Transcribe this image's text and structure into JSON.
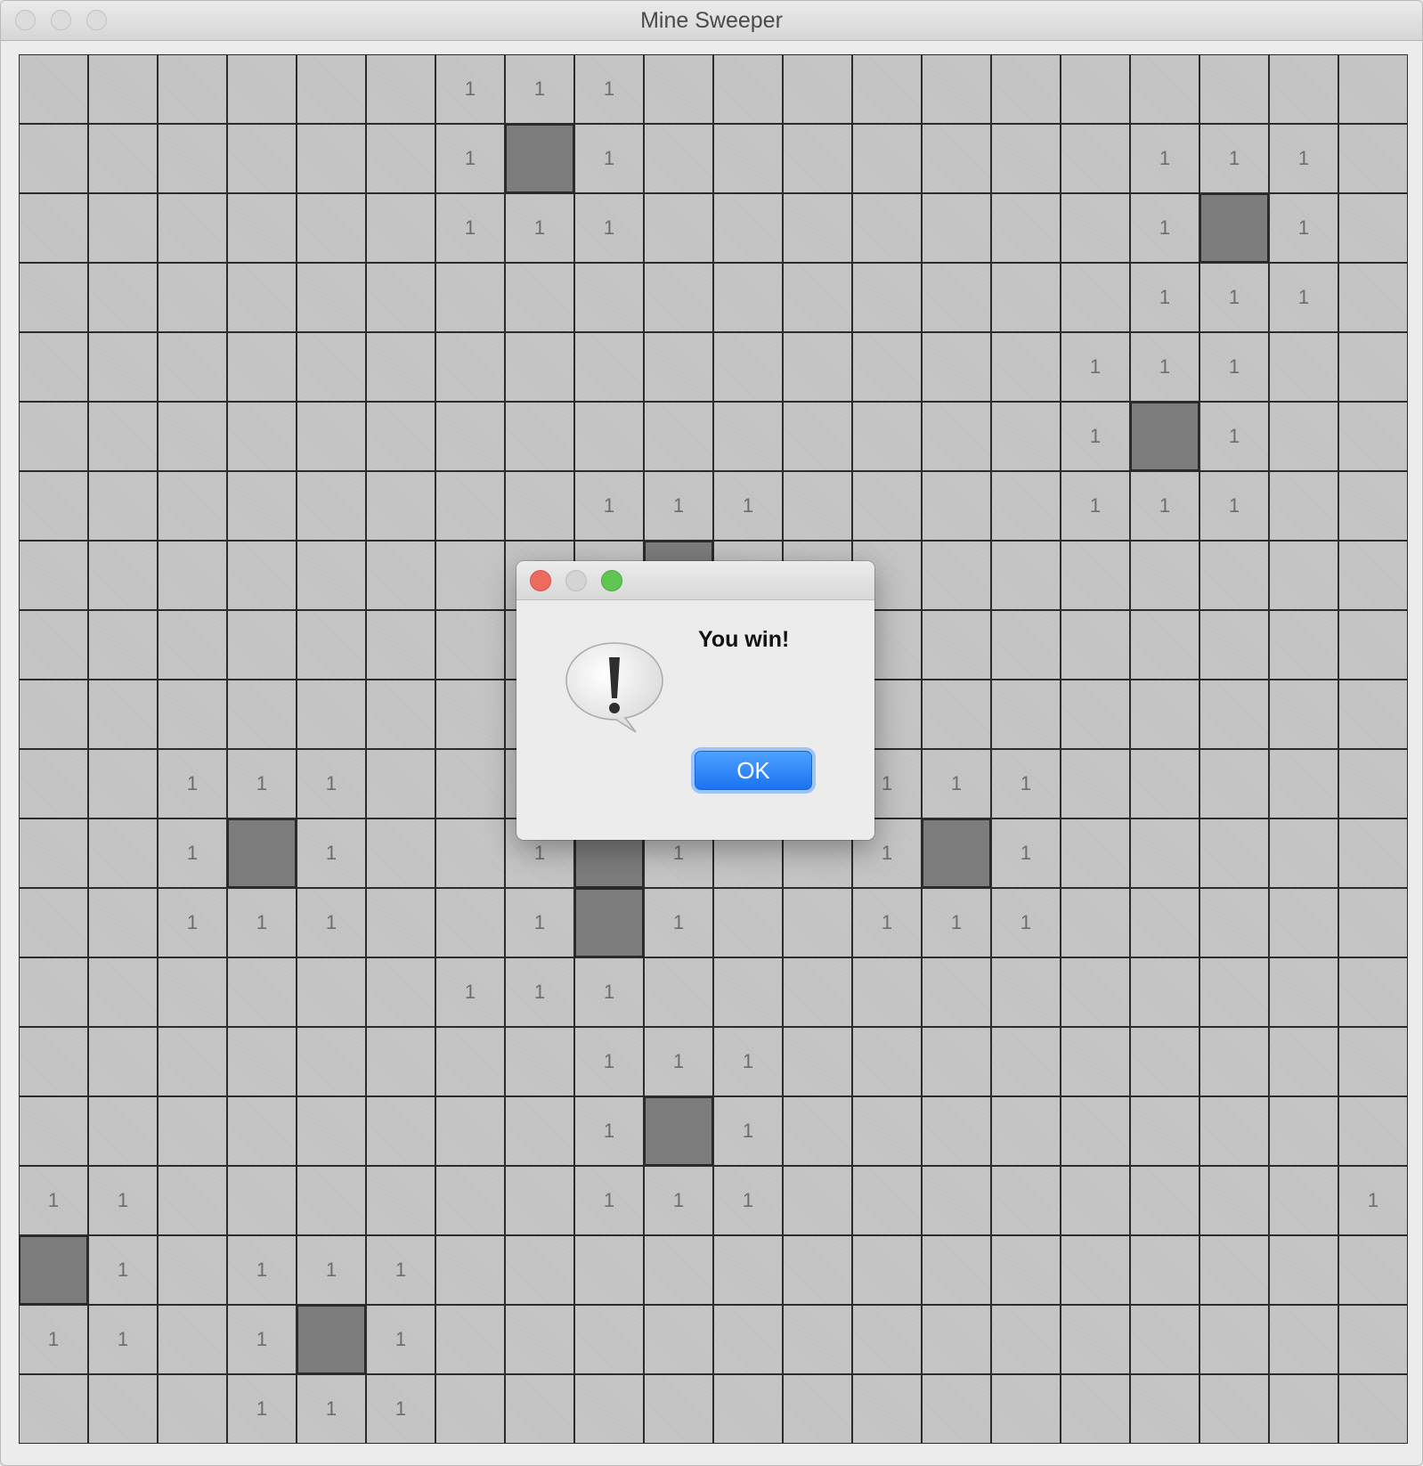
{
  "window": {
    "title": "Mine Sweeper"
  },
  "board": {
    "rows": 20,
    "cols": 20,
    "cells": [
      "......111...........",
      "......1#1.......111.",
      "......111.......1#1.",
      "................111.",
      "...............111..",
      "...............1#1..",
      "........111....111..",
      ".........#..........",
      "....................",
      "....................",
      "..111..111..111.....",
      "..1#1..1#1..1#1.....",
      "..111..1#1..111.....",
      "......111...........",
      "........111.........",
      "........1#1.........",
      "11......111........1",
      "#1.111..............",
      "11.1#1..............",
      "...111.............."
    ]
  },
  "dialog": {
    "message": "You win!",
    "ok_label": "OK",
    "icon": "alert-exclamation-icon"
  }
}
